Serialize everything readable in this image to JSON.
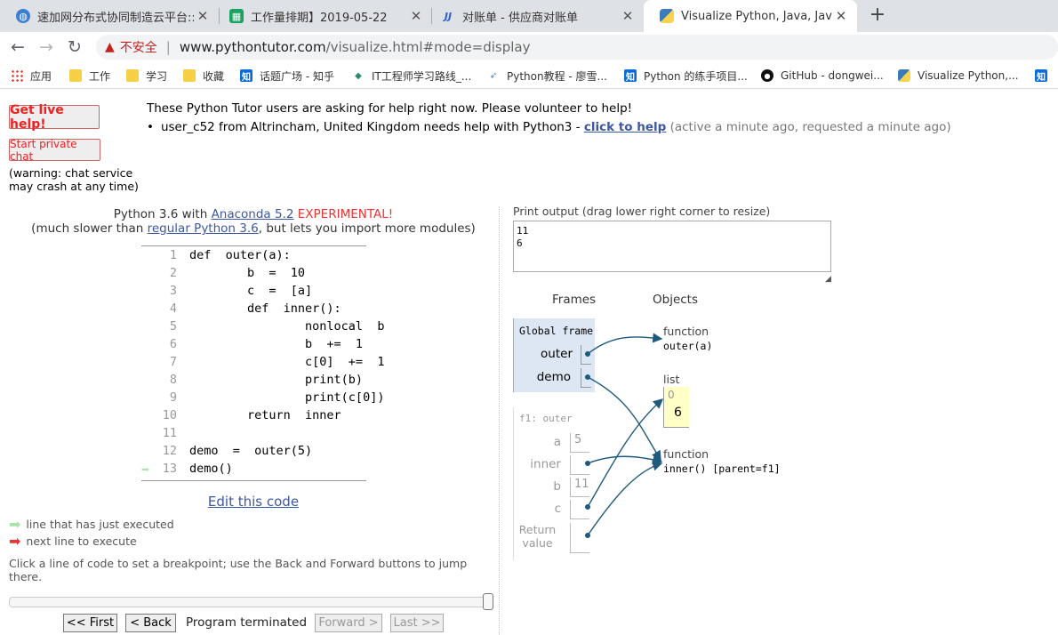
{
  "browser": {
    "tabs": [
      {
        "title": "速加网分布式协同制造云平台::Bu"
      },
      {
        "title": "工作量排期】2019-05-22"
      },
      {
        "title": "对账单 - 供应商对账单"
      },
      {
        "title": "Visualize Python, Java, JavaScr"
      }
    ],
    "security_label": "不安全",
    "url_host": "www.pythontutor.com",
    "url_path": "/visualize.html#mode=display",
    "bookmarks": [
      "应用",
      "工作",
      "学习",
      "收藏",
      "话题广场 - 知乎",
      "IT工程师学习路线_...",
      "Python教程 - 廖雪...",
      "Python 的练手项目...",
      "GitHub - dongwei...",
      "Visualize Python,..."
    ]
  },
  "help": {
    "live_button": "Get live help!",
    "private_chat_button": "Start private chat",
    "warning": "(warning: chat service may crash at any time)",
    "heading": "These Python Tutor users are asking for help right now. Please volunteer to help!",
    "request_user": "user_c52 from Altrincham, United Kingdom needs help with Python3 - ",
    "request_link": "click to help",
    "request_status": " (active a minute ago, requested a minute ago)"
  },
  "editor": {
    "lang_prefix": "Python 3.6 with ",
    "lang_link": "Anaconda 5.2",
    "lang_experimental": " EXPERIMENTAL!",
    "sub_prefix": "(much slower than ",
    "sub_link": "regular Python 3.6",
    "sub_suffix": ", but lets you import more modules)",
    "code": [
      {
        "n": "1",
        "text": "def  outer(a):"
      },
      {
        "n": "2",
        "text": "        b  =  10"
      },
      {
        "n": "3",
        "text": "        c  =  [a]"
      },
      {
        "n": "4",
        "text": "        def  inner():"
      },
      {
        "n": "5",
        "text": "                nonlocal  b"
      },
      {
        "n": "6",
        "text": "                b  +=  1"
      },
      {
        "n": "7",
        "text": "                c[0]  +=  1"
      },
      {
        "n": "8",
        "text": "                print(b)"
      },
      {
        "n": "9",
        "text": "                print(c[0])"
      },
      {
        "n": "10",
        "text": "        return  inner"
      },
      {
        "n": "11",
        "text": ""
      },
      {
        "n": "12",
        "text": "demo  =  outer(5)"
      },
      {
        "n": "13",
        "text": "demo()"
      }
    ],
    "current_line": "13",
    "edit_link": "Edit this code",
    "legend_executed": "line that has just executed",
    "legend_next": "next line to execute",
    "breakpoint_help": "Click a line of code to set a breakpoint; use the Back and Forward buttons to jump there.",
    "status": "Program terminated",
    "first_button": "<< First",
    "back_button": "< Back",
    "forward_button": "Forward >",
    "last_button": "Last >>"
  },
  "output": {
    "label": "Print output (drag lower right corner to resize)",
    "lines": "11\n6"
  },
  "viz": {
    "frames_header": "Frames",
    "objects_header": "Objects",
    "global_frame_title": "Global frame",
    "global_vars": [
      "outer",
      "demo"
    ],
    "f1_title": "f1: outer",
    "f1_vars": [
      {
        "name": "a",
        "value": "5"
      },
      {
        "name": "inner",
        "value": ""
      },
      {
        "name": "b",
        "value": "11"
      },
      {
        "name": "c",
        "value": ""
      },
      {
        "name": "Return value",
        "value": ""
      }
    ],
    "func_outer_type": "function",
    "func_outer_sig": "outer(a)",
    "list_type": "list",
    "list_index": "0",
    "list_value": "6",
    "func_inner_type": "function",
    "func_inner_sig": "inner() [parent=f1]"
  }
}
